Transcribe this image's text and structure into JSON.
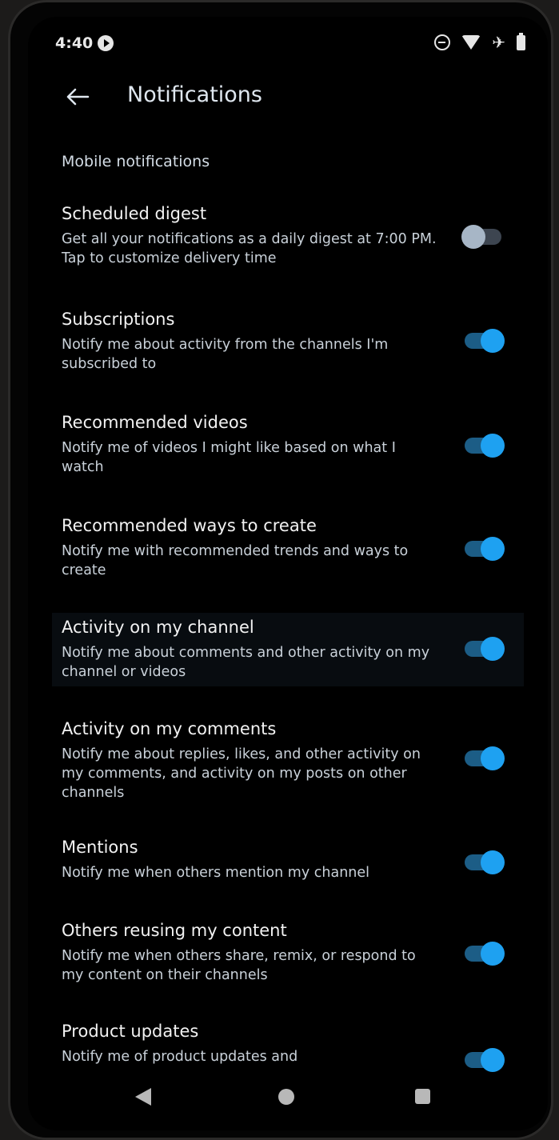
{
  "status_bar": {
    "time": "4:40"
  },
  "app_bar": {
    "title": "Notifications"
  },
  "section": {
    "header": "Mobile notifications"
  },
  "settings": [
    {
      "title": "Scheduled digest",
      "description": "Get all your notifications as a daily digest at 7:00 PM. Tap to customize delivery time",
      "enabled": false
    },
    {
      "title": "Subscriptions",
      "description": "Notify me about activity from the channels I'm subscribed to",
      "enabled": true
    },
    {
      "title": "Recommended videos",
      "description": "Notify me of videos I might like based on what I watch",
      "enabled": true
    },
    {
      "title": "Recommended ways to create",
      "description": "Notify me with recommended trends and ways to create",
      "enabled": true
    },
    {
      "title": "Activity on my channel",
      "description": "Notify me about comments and other activity on my channel or videos",
      "enabled": true
    },
    {
      "title": "Activity on my comments",
      "description": "Notify me about replies, likes, and other activity on my comments, and activity on my posts on other channels",
      "enabled": true
    },
    {
      "title": "Mentions",
      "description": "Notify me when others mention my channel",
      "enabled": true
    },
    {
      "title": "Others reusing my content",
      "description": "Notify me when others share, remix, or respond to my content on their channels",
      "enabled": true
    },
    {
      "title": "Product updates",
      "description": "Notify me of product updates and",
      "enabled": true
    }
  ],
  "colors": {
    "toggle_on": "#1ea1f1",
    "toggle_off": "#a7b6c6",
    "background": "#000000"
  }
}
